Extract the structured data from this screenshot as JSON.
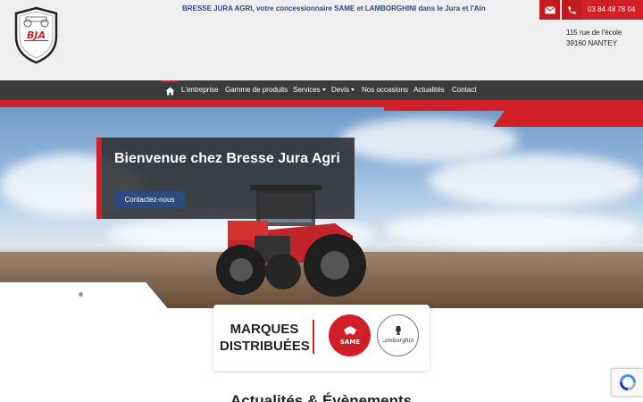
{
  "header": {
    "logo_text": "BJA",
    "tagline": "BRESSE JURA AGRI, votre concessionnaire SAME et LAMBORGHINI dans le Jura et l'Ain",
    "phone": "03 84 48 78 04",
    "address_line1": "115 rue de l'école",
    "address_line2": "39160 NANTEY"
  },
  "nav": {
    "items": [
      {
        "label": "L'entreprise"
      },
      {
        "label": "Gamme de produits"
      },
      {
        "label": "Services"
      },
      {
        "label": "Devis"
      },
      {
        "label": "Nos occasions"
      },
      {
        "label": "Actualités"
      },
      {
        "label": "Contact"
      }
    ]
  },
  "hero": {
    "title": "Bienvenue chez Bresse Jura Agri",
    "button": "Contactez-nous"
  },
  "brands": {
    "title": "MARQUES DISTRIBUÉES",
    "same_logo_text": "SAME",
    "lamborghini_logo_text": "Lamborghini"
  },
  "news": {
    "title": "Actualités & Évènements"
  },
  "colors": {
    "accent": "#d01f26",
    "primary": "#2c4a7a",
    "nav_bg": "#3a3b3d"
  }
}
